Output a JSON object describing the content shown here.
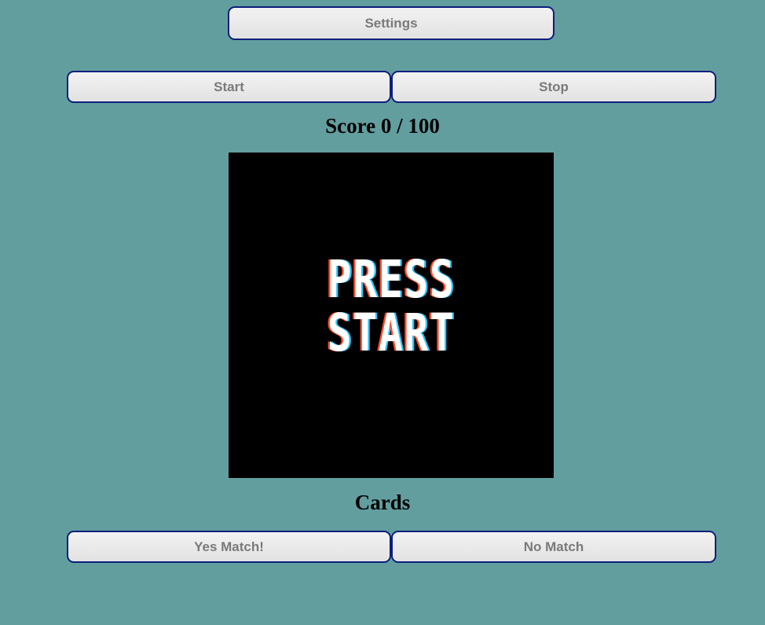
{
  "settings": {
    "label": "Settings"
  },
  "controls": {
    "start_label": "Start",
    "stop_label": "Stop"
  },
  "score": {
    "text": "Score 0 / 100",
    "current": 0,
    "max": 100
  },
  "game_screen": {
    "line1": "PRESS",
    "line2": "START",
    "background": "#000000",
    "text_color": "#ffffff"
  },
  "cards": {
    "heading": "Cards",
    "yes_label": "Yes Match!",
    "no_label": "No Match"
  },
  "colors": {
    "page_background": "#639e9f",
    "button_border": "#0b1f7a",
    "button_text": "#7a7a7a"
  }
}
